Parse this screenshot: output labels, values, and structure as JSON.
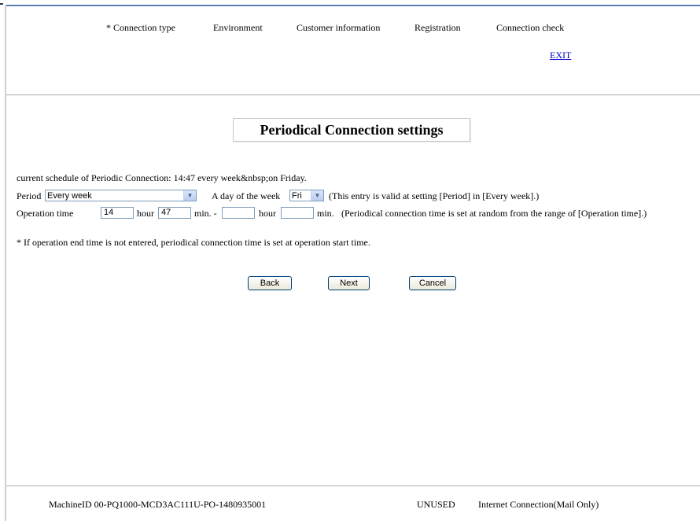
{
  "steps": [
    {
      "label": "* Connection type"
    },
    {
      "label": "Environment"
    },
    {
      "label": "Customer information"
    },
    {
      "label": "Registration"
    },
    {
      "label": "Connection check"
    }
  ],
  "exit_label": "EXIT",
  "page_title": "Periodical Connection settings",
  "current_schedule": "current schedule of Periodic Connection: 14:47 every week&nbsp;on Friday.",
  "period": {
    "label": "Period",
    "selected": "Every week",
    "day_label": "A day of the week",
    "day_selected": "Fri",
    "note": "(This entry is valid at setting [Period] in [Every week].)"
  },
  "operation": {
    "label": "Operation time",
    "start_hour": "14",
    "hour_label": "hour",
    "start_min": "47",
    "min_dash_label": "min. -",
    "end_hour": "",
    "end_hour_label": "hour",
    "end_min": "",
    "end_min_label": "min.",
    "note": "(Periodical connection time is set at random from the range of [Operation time].)"
  },
  "footnote": "* If operation end time is not entered, periodical connection time is set at operation start time.",
  "buttons": {
    "back": "Back",
    "next": "Next",
    "cancel": "Cancel"
  },
  "status_bar": {
    "machine_id": "MachineID  00-PQ1000-MCD3AC111U-PO-1480935001",
    "state": "UNUSED",
    "connection": "Internet Connection(Mail Only)"
  }
}
